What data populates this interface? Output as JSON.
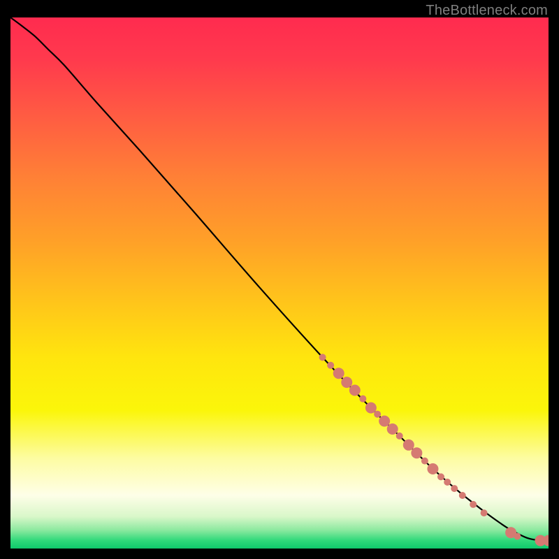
{
  "attribution": "TheBottleneck.com",
  "chart_data": {
    "type": "line",
    "title": "",
    "xlabel": "",
    "ylabel": "",
    "xlim": [
      0,
      100
    ],
    "ylim": [
      0,
      100
    ],
    "grid": false,
    "legend": false,
    "background_gradient_stops": [
      {
        "pct": 0.0,
        "color": "#ff2b4f"
      },
      {
        "pct": 0.08,
        "color": "#ff3a4d"
      },
      {
        "pct": 0.18,
        "color": "#ff5a43"
      },
      {
        "pct": 0.3,
        "color": "#ff8036"
      },
      {
        "pct": 0.42,
        "color": "#ffa028"
      },
      {
        "pct": 0.54,
        "color": "#ffc61a"
      },
      {
        "pct": 0.64,
        "color": "#ffe50e"
      },
      {
        "pct": 0.74,
        "color": "#fbf60a"
      },
      {
        "pct": 0.83,
        "color": "#fdfca2"
      },
      {
        "pct": 0.9,
        "color": "#fefee8"
      },
      {
        "pct": 0.94,
        "color": "#d9f7c9"
      },
      {
        "pct": 0.965,
        "color": "#8de9a0"
      },
      {
        "pct": 0.985,
        "color": "#2fd97a"
      },
      {
        "pct": 1.0,
        "color": "#0fc96b"
      }
    ],
    "series": [
      {
        "name": "bottleneck-curve",
        "color": "#000000",
        "x": [
          0.0,
          2.0,
          4.5,
          7.0,
          10.0,
          16.0,
          24.0,
          34.0,
          46.0,
          58.0,
          66.0,
          72.0,
          78.0,
          83.0,
          88.0,
          91.0,
          93.0,
          96.0,
          98.5,
          100.0
        ],
        "y": [
          100.0,
          98.5,
          96.5,
          94.0,
          91.0,
          84.0,
          75.0,
          63.5,
          49.5,
          36.0,
          27.5,
          21.5,
          15.5,
          11.0,
          7.0,
          4.8,
          3.5,
          2.0,
          1.5,
          1.5
        ]
      }
    ],
    "markers": {
      "name": "highlighted-points",
      "color": "#d57a72",
      "radius_small": 5,
      "radius_large": 8,
      "points": [
        {
          "x": 58.0,
          "y": 36.0,
          "r": "small"
        },
        {
          "x": 59.5,
          "y": 34.5,
          "r": "small"
        },
        {
          "x": 61.0,
          "y": 33.0,
          "r": "large"
        },
        {
          "x": 62.5,
          "y": 31.3,
          "r": "large"
        },
        {
          "x": 64.0,
          "y": 29.8,
          "r": "large"
        },
        {
          "x": 65.5,
          "y": 28.2,
          "r": "small"
        },
        {
          "x": 67.0,
          "y": 26.5,
          "r": "large"
        },
        {
          "x": 68.2,
          "y": 25.3,
          "r": "small"
        },
        {
          "x": 69.5,
          "y": 24.0,
          "r": "large"
        },
        {
          "x": 71.0,
          "y": 22.5,
          "r": "large"
        },
        {
          "x": 72.3,
          "y": 21.2,
          "r": "small"
        },
        {
          "x": 74.0,
          "y": 19.5,
          "r": "large"
        },
        {
          "x": 75.5,
          "y": 18.0,
          "r": "large"
        },
        {
          "x": 77.0,
          "y": 16.5,
          "r": "small"
        },
        {
          "x": 78.5,
          "y": 15.0,
          "r": "large"
        },
        {
          "x": 80.0,
          "y": 13.5,
          "r": "small"
        },
        {
          "x": 81.2,
          "y": 12.5,
          "r": "small"
        },
        {
          "x": 82.5,
          "y": 11.3,
          "r": "small"
        },
        {
          "x": 84.0,
          "y": 10.0,
          "r": "small"
        },
        {
          "x": 86.0,
          "y": 8.3,
          "r": "small"
        },
        {
          "x": 88.0,
          "y": 6.7,
          "r": "small"
        },
        {
          "x": 93.0,
          "y": 3.0,
          "r": "large"
        },
        {
          "x": 94.2,
          "y": 2.3,
          "r": "small"
        },
        {
          "x": 98.5,
          "y": 1.5,
          "r": "large"
        },
        {
          "x": 100.0,
          "y": 1.5,
          "r": "large"
        }
      ]
    }
  }
}
